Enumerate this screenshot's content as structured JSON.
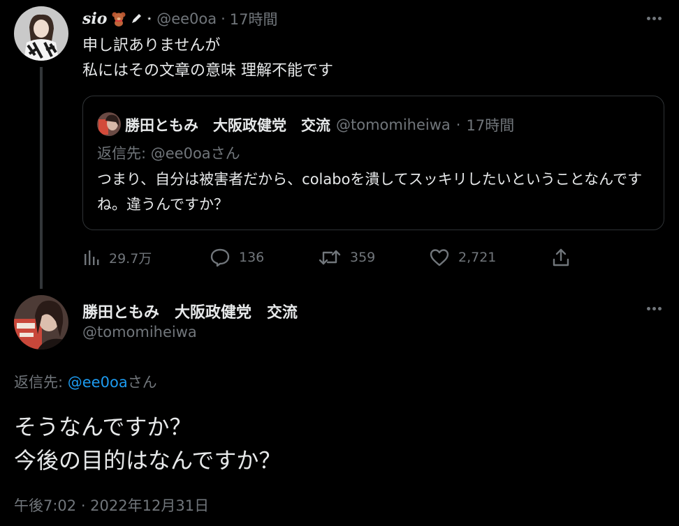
{
  "tweet1": {
    "display_name": "sio",
    "name_extra": "⋆",
    "handle": "@ee0oa",
    "separator": "·",
    "time": "17時間",
    "lines": [
      "申し訳ありませんが",
      "私にはその文章の意味 理解不能です"
    ]
  },
  "quote": {
    "display_name": "勝田ともみ　大阪政健党　交流",
    "handle": "@tomomiheiwa",
    "separator": "·",
    "time": "17時間",
    "reply_to": "返信先: @ee0oaさん",
    "text": "つまり、自分は被害者だから、colaboを潰してスッキリしたいということなんですね。違うんですか？"
  },
  "actions": {
    "views": "29.7万",
    "replies": "136",
    "retweets": "359",
    "likes": "2,721"
  },
  "tweet2": {
    "display_name": "勝田ともみ　大阪政健党　交流",
    "handle": "@tomomiheiwa",
    "reply_prefix": "返信先: ",
    "reply_mention": "@ee0oa",
    "reply_suffix": "さん",
    "lines": [
      "そうなんですか？",
      "今後の目的はなんですか？"
    ],
    "timestamp": "午後7:02 · 2022年12月31日"
  },
  "colors": {
    "background": "#000000",
    "text": "#e7e9ea",
    "muted": "#71767b",
    "link": "#1d9bf0",
    "border": "#2f3336"
  }
}
